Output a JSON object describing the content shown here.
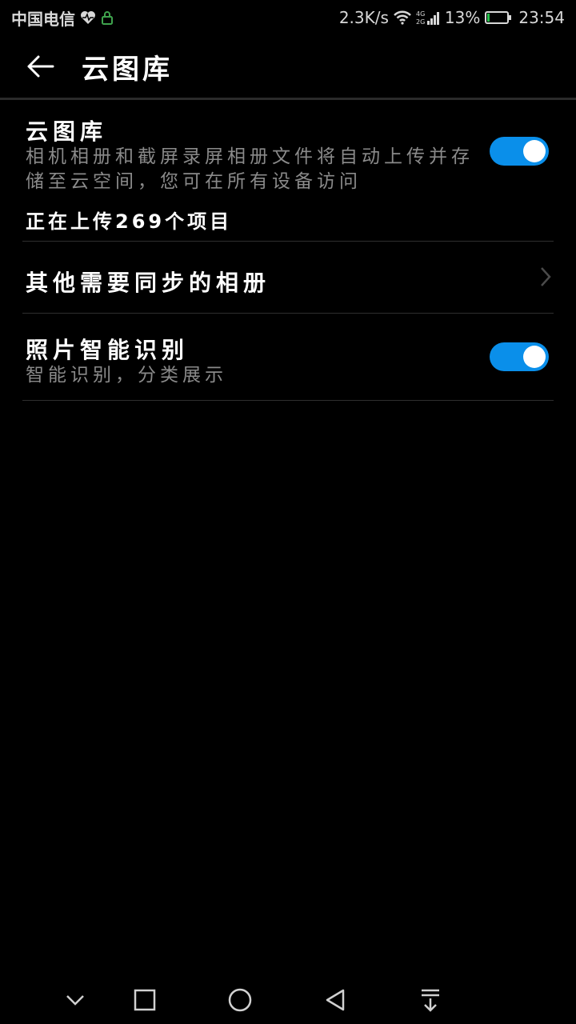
{
  "status_bar": {
    "carrier": "中国电信",
    "net_speed": "2.3K/s",
    "network_type": "4G 2G",
    "battery_percent": "13%",
    "battery_level": 0.13,
    "time": "23:54",
    "battery_color": "#25c04a"
  },
  "app_bar": {
    "title": "云图库",
    "back_icon": "back-arrow-icon"
  },
  "settings": {
    "cloud_gallery": {
      "title": "云图库",
      "description": "相机相册和截屏录屏相册文件将自动上传并存储至云空间，您可在所有设备访问",
      "status": "正在上传269个项目",
      "enabled": true
    },
    "other_albums": {
      "title": "其他需要同步的相册",
      "icon": "chevron-right-icon"
    },
    "smart_recognition": {
      "title": "照片智能识别",
      "description": "智能识别，分类展示",
      "enabled": true
    }
  },
  "nav_bar": {
    "buttons": [
      "chevron-down-icon",
      "square-icon",
      "circle-icon",
      "triangle-back-icon",
      "notification-pull-icon"
    ]
  },
  "colors": {
    "background": "#000000",
    "accent": "#0a8fea",
    "secondary_text": "#8a8a8a"
  }
}
